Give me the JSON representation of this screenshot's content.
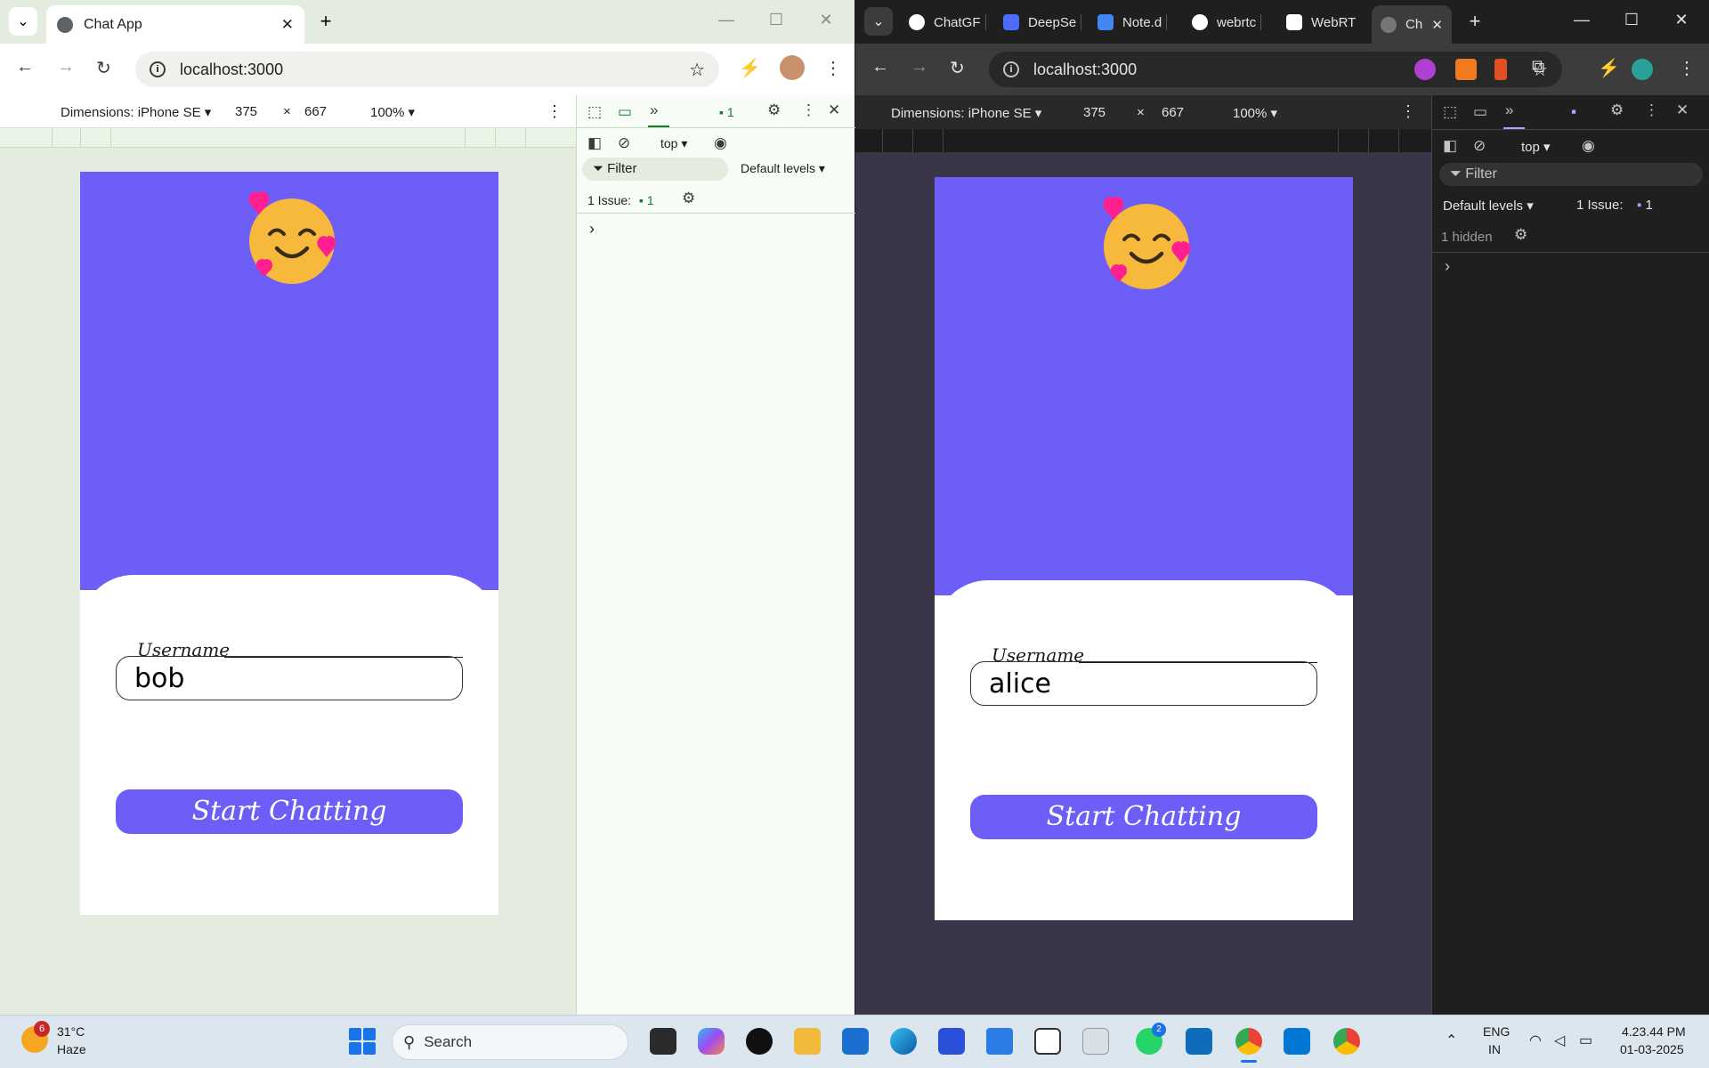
{
  "left_window": {
    "tab_title": "Chat App",
    "url": "localhost:3000",
    "device_toolbar": {
      "dimensions_label": "Dimensions: iPhone SE ▾",
      "width": "375",
      "times": "×",
      "height": "667",
      "zoom": "100% ▾"
    },
    "devtools": {
      "issues_badge": "1",
      "context": "top ▾",
      "filter": "Filter",
      "levels": "Default levels ▾",
      "issue_text": "1 Issue:",
      "issue_count": "1",
      "prompt": "›"
    },
    "app": {
      "username_label": "Username",
      "username_value": "bob",
      "start_button": "Start Chatting"
    }
  },
  "right_window": {
    "tabs": [
      {
        "label": "ChatGF",
        "color": "#ffffff"
      },
      {
        "label": "DeepSe",
        "color": "#4d6bfe"
      },
      {
        "label": "Note.d",
        "color": "#4285f4"
      },
      {
        "label": "webrtc",
        "color": "#ffffff"
      },
      {
        "label": "WebRT",
        "color": "#ffffff"
      }
    ],
    "active_tab": "Ch",
    "url": "localhost:3000",
    "device_toolbar": {
      "dimensions_label": "Dimensions: iPhone SE ▾",
      "width": "375",
      "times": "×",
      "height": "667",
      "zoom": "100% ▾"
    },
    "devtools": {
      "context": "top ▾",
      "filter": "Filter",
      "levels": "Default levels ▾",
      "issue_text": "1 Issue:",
      "issue_count": "1",
      "hidden": "1 hidden",
      "prompt": "›"
    },
    "app": {
      "username_label": "Username",
      "username_value": "alice",
      "start_button": "Start Chatting"
    }
  },
  "taskbar": {
    "weather_badge": "6",
    "temperature": "31°C",
    "condition": "Haze",
    "search": "Search",
    "whatsapp_badge": "2",
    "language": "ENG",
    "region": "IN",
    "time": "4.23.44 PM",
    "date": "01-03-2025"
  },
  "colors": {
    "app_purple": "#6c5ef6",
    "heart_pink": "#ff1f8e",
    "emoji_yellow": "#f6b93b"
  }
}
